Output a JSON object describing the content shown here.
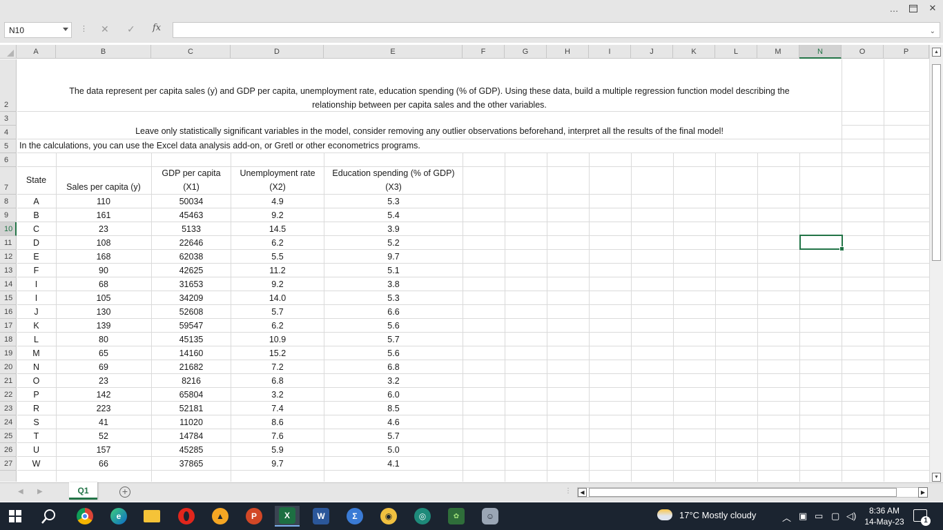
{
  "window": {
    "more_icon": "…",
    "restore_icon": "restore-icon",
    "close_icon": "✕"
  },
  "formula_bar": {
    "name_box": "N10",
    "cancel_glyph": "✕",
    "enter_glyph": "✓",
    "fx_label": "fx",
    "formula_value": ""
  },
  "columns": [
    "A",
    "B",
    "C",
    "D",
    "E",
    "F",
    "G",
    "H",
    "I",
    "J",
    "K",
    "L",
    "M",
    "N",
    "O",
    "P"
  ],
  "selected_column": "N",
  "rows": [
    "2",
    "3",
    "4",
    "5",
    "6",
    "7",
    "8",
    "9",
    "10",
    "11",
    "12",
    "13",
    "14",
    "15",
    "16",
    "17",
    "18",
    "19",
    "20",
    "21",
    "22",
    "23",
    "24",
    "25",
    "26",
    "27"
  ],
  "selected_row": "10",
  "sheet": {
    "intro_line1": "The data represent per capita sales (y) and GDP per capita, unemployment rate, education spending (% of GDP). Using these data, build a multiple regression function model describing the",
    "intro_line2": "relationship between per capita sales and the other variables.",
    "row3": "Leave only statistically significant variables in the model, consider removing any outlier observations beforehand, interpret all the results of the final model!",
    "row4": "In the calculations, you can use the Excel data analysis add-on, or Gretl or other econometrics programs.",
    "headers": {
      "state": "State",
      "sales": "Sales per capita (y)",
      "gdp_1": "GDP per capita",
      "gdp_2": "(X1)",
      "unemp_1": "Unemployment rate",
      "unemp_2": "(X2)",
      "edu_1": "Education spending (% of GDP)",
      "edu_2": "(X3)"
    },
    "data": [
      [
        "A",
        "110",
        "50034",
        "4.9",
        "5.3"
      ],
      [
        "B",
        "161",
        "45463",
        "9.2",
        "5.4"
      ],
      [
        "C",
        "23",
        "5133",
        "14.5",
        "3.9"
      ],
      [
        "D",
        "108",
        "22646",
        "6.2",
        "5.2"
      ],
      [
        "E",
        "168",
        "62038",
        "5.5",
        "9.7"
      ],
      [
        "F",
        "90",
        "42625",
        "11.2",
        "5.1"
      ],
      [
        "I",
        "68",
        "31653",
        "9.2",
        "3.8"
      ],
      [
        "I",
        "105",
        "34209",
        "14.0",
        "5.3"
      ],
      [
        "J",
        "130",
        "52608",
        "5.7",
        "6.6"
      ],
      [
        "K",
        "139",
        "59547",
        "6.2",
        "5.6"
      ],
      [
        "L",
        "80",
        "45135",
        "10.9",
        "5.7"
      ],
      [
        "M",
        "65",
        "14160",
        "15.2",
        "5.6"
      ],
      [
        "N",
        "69",
        "21682",
        "7.2",
        "6.8"
      ],
      [
        "O",
        "23",
        "8216",
        "6.8",
        "3.2"
      ],
      [
        "P",
        "142",
        "65804",
        "3.2",
        "6.0"
      ],
      [
        "R",
        "223",
        "52181",
        "7.4",
        "8.5"
      ],
      [
        "S",
        "41",
        "11020",
        "8.6",
        "4.6"
      ],
      [
        "T",
        "52",
        "14784",
        "7.6",
        "5.7"
      ],
      [
        "U",
        "157",
        "45285",
        "5.9",
        "5.0"
      ],
      [
        "W",
        "66",
        "37865",
        "9.7",
        "4.1"
      ]
    ]
  },
  "sheet_tabs": {
    "active_tab": "Q1",
    "add_glyph": "+"
  },
  "taskbar": {
    "weather": "17°C  Mostly cloudy",
    "time": "8:36 AM",
    "date": "14-May-23",
    "notification_count": "1",
    "apps": [
      "start-icon",
      "search-icon",
      "chrome-icon",
      "edge-icon",
      "file-explorer-icon",
      "opera-icon",
      "vlc-icon",
      "powerpoint-icon",
      "excel-icon",
      "word-icon",
      "calculator-icon",
      "app-icon",
      "app-icon-2",
      "app-icon-3",
      "app-icon-4"
    ]
  },
  "colors": {
    "excel_green": "#217346",
    "taskbar_bg": "#1b2430",
    "header_bg": "#e6e6e6"
  }
}
